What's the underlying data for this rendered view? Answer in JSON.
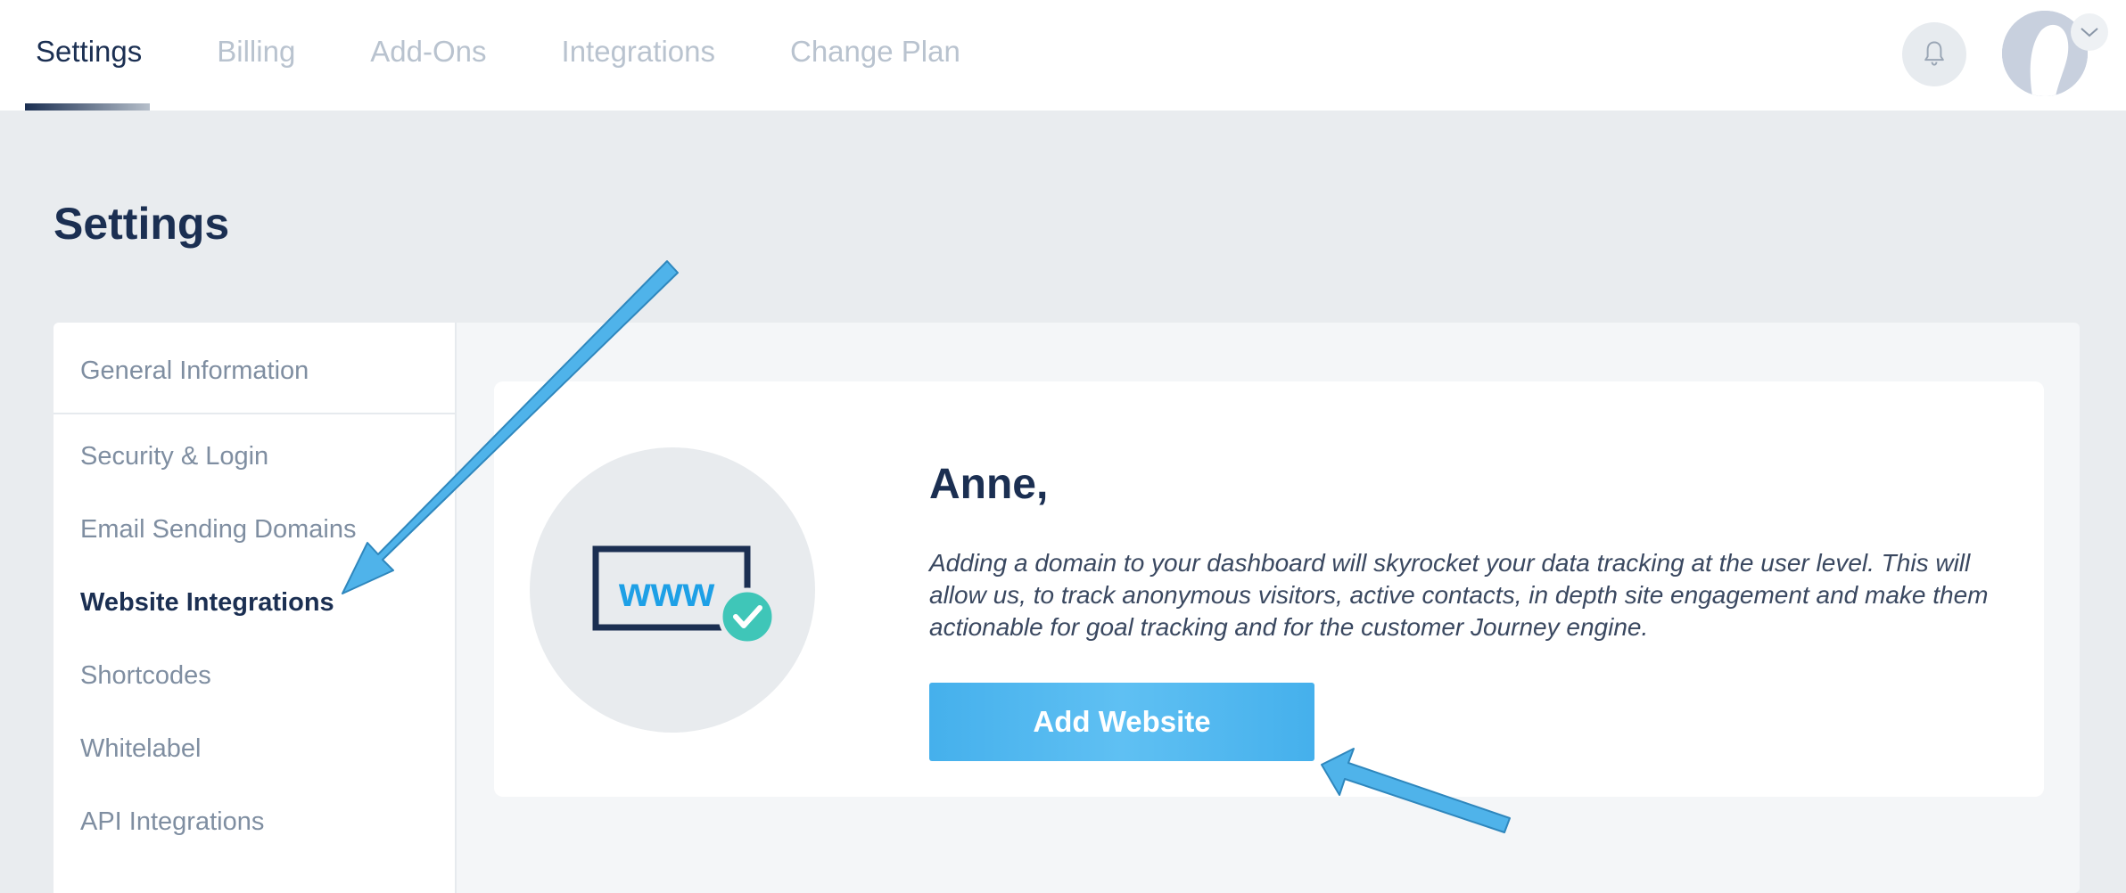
{
  "top_tabs": [
    {
      "label": "Settings",
      "active": true
    },
    {
      "label": "Billing",
      "active": false
    },
    {
      "label": "Add-Ons",
      "active": false
    },
    {
      "label": "Integrations",
      "active": false
    },
    {
      "label": "Change Plan",
      "active": false
    }
  ],
  "header": {
    "notification_icon": "bell-icon",
    "avatar_icon": "user-avatar",
    "menu_icon": "chevron-down-icon"
  },
  "page": {
    "title": "Settings"
  },
  "sidebar": {
    "items": [
      {
        "label": "General Information",
        "active": false
      },
      {
        "label": "Security & Login",
        "active": false
      },
      {
        "label": "Email Sending Domains",
        "active": false
      },
      {
        "label": "Website Integrations",
        "active": true
      },
      {
        "label": "Shortcodes",
        "active": false
      },
      {
        "label": "Whitelabel",
        "active": false
      },
      {
        "label": "API Integrations",
        "active": false
      }
    ]
  },
  "content": {
    "illustration_text": "www",
    "greeting": "Anne,",
    "description": "Adding a domain to your dashboard will skyrocket your data tracking at the user level. This will allow us, to track anonymous visitors, active contacts, in depth site engagement and make them actionable for goal tracking and for the customer Journey engine.",
    "add_button_label": "Add Website"
  },
  "colors": {
    "primary_text": "#1b2f52",
    "muted_text": "#b9c3cf",
    "accent_blue": "#4fb6ef",
    "check_teal": "#3fc6b8",
    "annotation_arrow": "#4fb3ea"
  }
}
